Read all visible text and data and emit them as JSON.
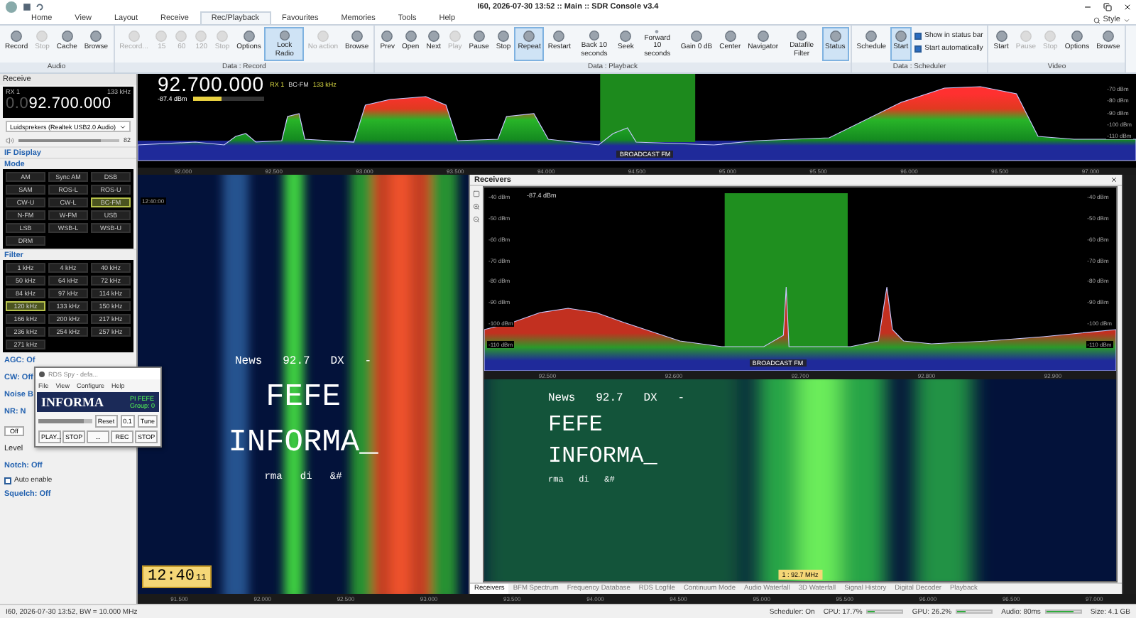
{
  "window": {
    "title": "I60, 2026-07-30 13:52 :: Main :: SDR Console v3.4"
  },
  "menu_tabs": [
    {
      "label": "Home",
      "selected": false
    },
    {
      "label": "View",
      "selected": false
    },
    {
      "label": "Layout",
      "selected": false
    },
    {
      "label": "Receive",
      "selected": false
    },
    {
      "label": "Rec/Playback",
      "selected": true
    },
    {
      "label": "Favourites",
      "selected": false
    },
    {
      "label": "Memories",
      "selected": false
    },
    {
      "label": "Tools",
      "selected": false
    },
    {
      "label": "Help",
      "selected": false
    }
  ],
  "style_menu": "Style",
  "ribbon": [
    {
      "title": "Audio",
      "buttons": [
        {
          "label": "Record",
          "selected": false,
          "disabled": false
        },
        {
          "label": "Stop",
          "selected": false,
          "disabled": true
        },
        {
          "label": "Cache",
          "selected": false,
          "disabled": false
        },
        {
          "label": "Browse",
          "selected": false,
          "disabled": false
        }
      ]
    },
    {
      "title": "Data : Record",
      "buttons": [
        {
          "label": "Record...",
          "selected": false,
          "disabled": true
        },
        {
          "label": "15",
          "selected": false,
          "disabled": true
        },
        {
          "label": "60",
          "selected": false,
          "disabled": true
        },
        {
          "label": "120",
          "selected": false,
          "disabled": true
        },
        {
          "label": "Stop",
          "selected": false,
          "disabled": true
        },
        {
          "label": "Options",
          "selected": false,
          "disabled": false
        },
        {
          "label": "Lock Radio",
          "selected": true,
          "disabled": false
        },
        {
          "label": "No action",
          "selected": false,
          "disabled": true
        },
        {
          "label": "Browse",
          "selected": false,
          "disabled": false
        }
      ]
    },
    {
      "title": "Data : Playback",
      "buttons": [
        {
          "label": "Prev",
          "selected": false,
          "disabled": false
        },
        {
          "label": "Open",
          "selected": false,
          "disabled": false
        },
        {
          "label": "Next",
          "selected": false,
          "disabled": false
        },
        {
          "label": "Play",
          "selected": false,
          "disabled": true
        },
        {
          "label": "Pause",
          "selected": false,
          "disabled": false
        },
        {
          "label": "Stop",
          "selected": false,
          "disabled": false
        },
        {
          "label": "Repeat",
          "selected": true,
          "disabled": false
        },
        {
          "label": "Restart",
          "selected": false,
          "disabled": false
        },
        {
          "label": "Back 10 seconds",
          "selected": false,
          "disabled": false
        },
        {
          "label": "Seek",
          "selected": false,
          "disabled": false
        },
        {
          "label": "Forward 10 seconds",
          "selected": false,
          "disabled": false
        },
        {
          "label": "Gain 0 dB",
          "selected": false,
          "disabled": false
        },
        {
          "label": "Center",
          "selected": false,
          "disabled": false
        },
        {
          "label": "Navigator",
          "selected": false,
          "disabled": false
        },
        {
          "label": "Datafile Filter",
          "selected": false,
          "disabled": false
        },
        {
          "label": "Status",
          "selected": true,
          "disabled": false
        }
      ]
    },
    {
      "title": "Data : Scheduler",
      "buttons": [
        {
          "label": "Schedule",
          "selected": false,
          "disabled": false
        },
        {
          "label": "Start",
          "selected": true,
          "disabled": false
        }
      ],
      "checkboxes": [
        {
          "label": "Show in status bar",
          "checked": true
        },
        {
          "label": "Start automatically",
          "checked": true
        }
      ]
    },
    {
      "title": "Video",
      "buttons": [
        {
          "label": "Start",
          "selected": false,
          "disabled": false
        },
        {
          "label": "Pause",
          "selected": false,
          "disabled": true
        },
        {
          "label": "Stop",
          "selected": false,
          "disabled": true
        },
        {
          "label": "Options",
          "selected": false,
          "disabled": false
        },
        {
          "label": "Browse",
          "selected": false,
          "disabled": false
        }
      ]
    }
  ],
  "receive_panel": {
    "title": "Receive",
    "rx": "RX 1",
    "bandwidth": "133 kHz",
    "frequency_prefix": "0.0",
    "frequency": "92.700.000",
    "audio_device": "Luidsprekers (Realtek USB2.0 Audio)",
    "volume": {
      "level": 0.82,
      "reading": "82"
    },
    "if_display": "IF Display",
    "mode": {
      "title": "Mode",
      "buttons": [
        {
          "label": "AM",
          "selected": false
        },
        {
          "label": "Sync AM",
          "selected": false
        },
        {
          "label": "DSB",
          "selected": false
        },
        {
          "label": "SAM",
          "selected": false
        },
        {
          "label": "ROS-L",
          "selected": false
        },
        {
          "label": "ROS-U",
          "selected": false
        },
        {
          "label": "CW-U",
          "selected": false
        },
        {
          "label": "CW-L",
          "selected": false
        },
        {
          "label": "BC-FM",
          "selected": true
        },
        {
          "label": "N-FM",
          "selected": false
        },
        {
          "label": "W-FM",
          "selected": false
        },
        {
          "label": "USB",
          "selected": false
        },
        {
          "label": "LSB",
          "selected": false
        },
        {
          "label": "WSB-L",
          "selected": false
        },
        {
          "label": "WSB-U",
          "selected": false
        },
        {
          "label": "DRM",
          "selected": false
        }
      ]
    },
    "filter": {
      "title": "Filter",
      "buttons": [
        {
          "label": "1 kHz",
          "selected": false
        },
        {
          "label": "4 kHz",
          "selected": false
        },
        {
          "label": "40 kHz",
          "selected": false
        },
        {
          "label": "50 kHz",
          "selected": false
        },
        {
          "label": "64 kHz",
          "selected": false
        },
        {
          "label": "72 kHz",
          "selected": false
        },
        {
          "label": "84 kHz",
          "selected": false
        },
        {
          "label": "97 kHz",
          "selected": false
        },
        {
          "label": "114 kHz",
          "selected": false
        },
        {
          "label": "120 kHz",
          "selected": true
        },
        {
          "label": "133 kHz",
          "selected": false
        },
        {
          "label": "150 kHz",
          "selected": false
        },
        {
          "label": "166 kHz",
          "selected": false
        },
        {
          "label": "200 kHz",
          "selected": false
        },
        {
          "label": "217 kHz",
          "selected": false
        },
        {
          "label": "236 kHz",
          "selected": false
        },
        {
          "label": "254 kHz",
          "selected": false
        },
        {
          "label": "257 kHz",
          "selected": false
        },
        {
          "label": "271 kHz",
          "selected": false
        }
      ]
    },
    "settings": [
      {
        "kind": "header",
        "label": "AGC: Of"
      },
      {
        "kind": "header",
        "label": "CW: Off"
      },
      {
        "kind": "header",
        "label": "Noise B"
      },
      {
        "kind": "header",
        "label": "NR: N"
      },
      {
        "kind": "button",
        "label": "Off"
      },
      {
        "kind": "text",
        "label": "Level"
      },
      {
        "kind": "header",
        "label": "Notch: Off"
      },
      {
        "kind": "checkbox",
        "label": "Auto enable",
        "checked": false
      },
      {
        "kind": "header",
        "label": "Squelch: Off"
      }
    ]
  },
  "main_spectrum": {
    "frequency": "92.700.000",
    "rx": "RX 1",
    "mode": "BC-FM",
    "bandwidth": "133 kHz",
    "signal": "-87.4 dBm",
    "signal_meter": {
      "level": 0.4
    },
    "dbm_ticks": [
      "-70 dBm",
      "-80 dBm",
      "-90 dBm",
      "-100 dBm",
      "-110 dBm"
    ],
    "band_label": "BROADCAST FM",
    "freq_ticks": [
      "92.000",
      "92.500",
      "93.000",
      "93.500",
      "94.000",
      "94.500",
      "95.000",
      "95.500",
      "96.000",
      "96.500",
      "97.000"
    ]
  },
  "waterfall": {
    "time_label": "12:40:00",
    "rds_line": "News   92.7   DX   -",
    "ps_lines": [
      "FEFE",
      "INFORMA_"
    ],
    "radiotext": "rma   di   &#",
    "clock": "12:40",
    "clock_seconds": "11"
  },
  "rds_spy": {
    "title": "RDS Spy - defa...",
    "menu": [
      "File",
      "View",
      "Configure",
      "Help"
    ],
    "ps": "INFORMA",
    "pi": "PI FEFE",
    "group": "Group: 0",
    "tuning": {
      "level": 0.85
    },
    "reset": "Reset",
    "step": "0.1",
    "tune": "Tune",
    "buttons": [
      "PLAY...",
      "STOP",
      "...",
      "REC",
      "STOP"
    ]
  },
  "receivers": {
    "title": "Receivers",
    "signal": "-87.4 dBm",
    "dbm_ticks": [
      "-40 dBm",
      "-50 dBm",
      "-60 dBm",
      "-70 dBm",
      "-80 dBm",
      "-90 dBm",
      "-100 dBm",
      "-110 dBm"
    ],
    "dbm_ticks_right": [
      "-40 dBm",
      "-50 dBm",
      "-60 dBm",
      "-70 dBm",
      "-80 dBm",
      "-90 dBm",
      "-100 dBm",
      "-110 dBm"
    ],
    "band_label": "BROADCAST FM",
    "freq_ticks": [
      "92.500",
      "92.600",
      "92.700",
      "92.800",
      "92.900"
    ],
    "rds_line": "News   92.7   DX   -",
    "ps_lines": [
      "FEFE",
      "INFORMA_"
    ],
    "radiotext": "rma   di   &#",
    "marker": "1 : 92.7 MHz",
    "tabs": [
      {
        "label": "Receivers",
        "selected": true
      },
      {
        "label": "BFM Spectrum",
        "selected": false
      },
      {
        "label": "Frequency Database",
        "selected": false
      },
      {
        "label": "RDS Logfile",
        "selected": false
      },
      {
        "label": "Continuum Mode",
        "selected": false
      },
      {
        "label": "Audio Waterfall",
        "selected": false
      },
      {
        "label": "3D Waterfall",
        "selected": false
      },
      {
        "label": "Signal History",
        "selected": false
      },
      {
        "label": "Digital Decoder",
        "selected": false
      },
      {
        "label": "Playback",
        "selected": false
      }
    ]
  },
  "freq_axis": [
    "91.500",
    "92.000",
    "92.500",
    "93.000",
    "93.500",
    "94.000",
    "94.500",
    "95.000",
    "95.500",
    "96.000",
    "96.500",
    "97.000"
  ],
  "status_bar": {
    "left": "I60, 2026-07-30 13:52, BW = 10.000 MHz",
    "scheduler": "Scheduler: On",
    "meters": [
      {
        "label": "CPU: 17.7%",
        "level": 0.18
      },
      {
        "label": "GPU: 26.2%",
        "level": 0.26
      },
      {
        "label": "Audio: 80ms",
        "level": 0.8
      }
    ],
    "size": "Size: 4.1 GB"
  }
}
